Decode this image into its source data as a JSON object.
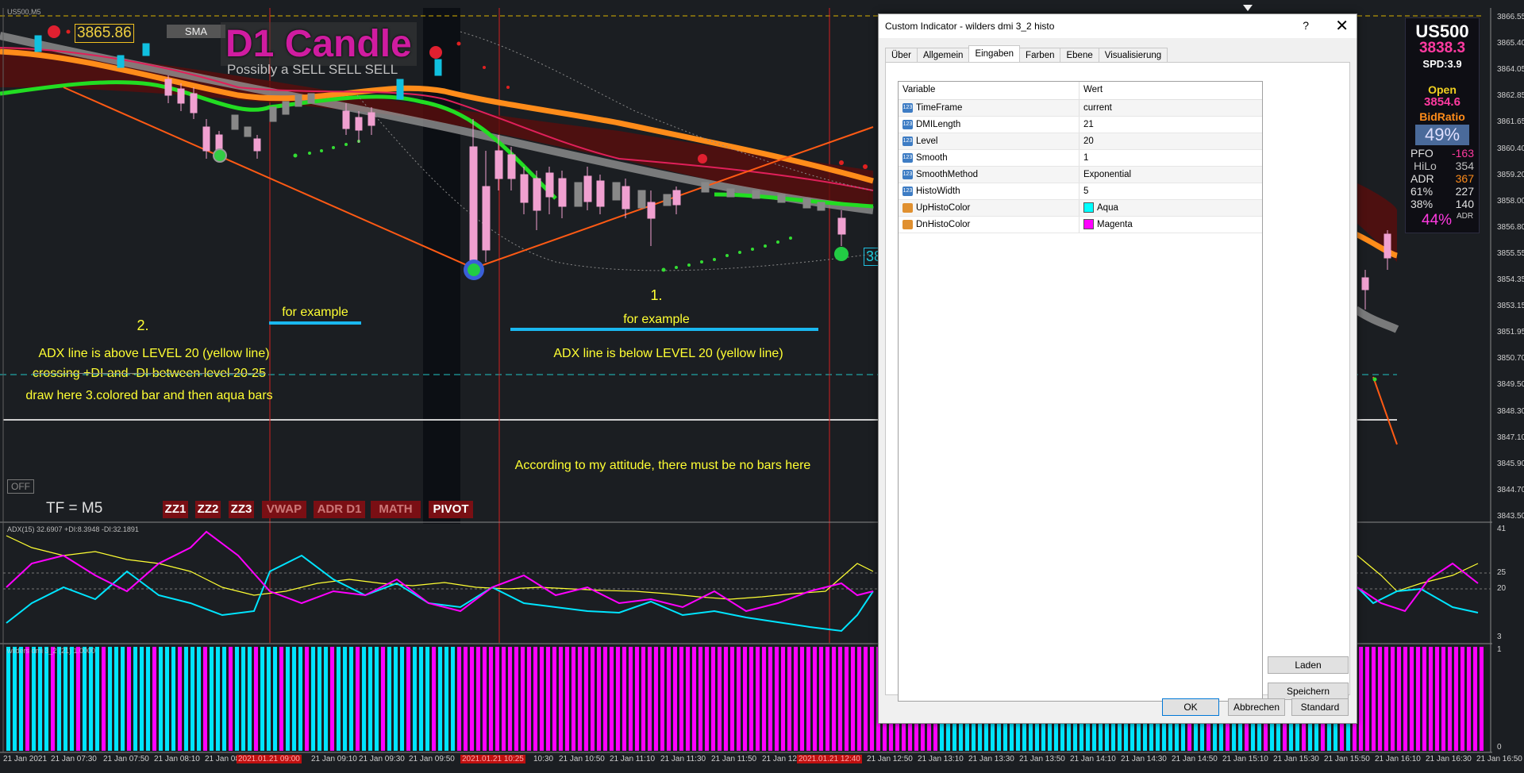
{
  "chart_window": {
    "title": "US500,M5",
    "current_price": "3865.86",
    "sma_label": "SMA",
    "d1_title": "D1 Candle",
    "d1_subtitle": "Possibly a SELL SELL SELL",
    "timeframe": "TF = M5",
    "off_label": "OFF",
    "bottom_price_box": "38",
    "buttons": [
      "ZZ1",
      "ZZ2",
      "ZZ3",
      "VWAP",
      "ADR D1",
      "MATH",
      "PIVOT"
    ],
    "annotations": {
      "label_2": "2.",
      "for_example_left": "for example",
      "adx_above": "ADX line is above LEVEL 20 (yellow line)",
      "crossing": "crossing +DI and -DI between level 20-25",
      "draw_here": "draw here 3.colored bar and then aqua bars",
      "label_1": "1.",
      "for_example_right": "for example",
      "adx_below": "ADX line is below LEVEL 20 (yellow line)",
      "no_bars": "According to my attitude, there must be no bars here"
    },
    "adx_title": "ADX(15) 32.6907 +DI:8.3948 -DI:32.1891",
    "histo_title": "wilders dmi 3_2 (21) 1.0000",
    "price_axis": [
      "3866.55",
      "3865.40",
      "3864.05",
      "3862.85",
      "3861.65",
      "3860.40",
      "3859.20",
      "3858.00",
      "3856.80",
      "3855.55",
      "3854.35",
      "3853.15",
      "3851.95",
      "3850.70",
      "3849.50",
      "3848.30",
      "3847.10",
      "3845.90",
      "3844.70",
      "3843.50"
    ],
    "adx_axis": [
      "41",
      "25",
      "20",
      "3"
    ],
    "histo_axis": [
      "1",
      "0"
    ],
    "time_axis": [
      "21 Jan 2021",
      "21 Jan 07:30",
      "21 Jan 07:50",
      "21 Jan 08:10",
      "21 Jan 08:",
      "2021.01.21 09:00",
      "21 Jan 09:10",
      "21 Jan 09:30",
      "21 Jan 09:50",
      "2021.01.21 10:25",
      "10:30",
      "21 Jan 10:50",
      "21 Jan 11:10",
      "21 Jan 11:30",
      "21 Jan 11:50",
      "21 Jan 12:",
      "2021.01.21 12:40",
      "21 Jan 12:50",
      "21 Jan 13:10",
      "21 Jan 13:30",
      "21 Jan 13:50",
      "21 Jan 14:10",
      "21 Jan 14:30",
      "21 Jan 14:50",
      "21 Jan 15:10",
      "21 Jan 15:30",
      "21 Jan 15:50",
      "21 Jan 16:10",
      "21 Jan 16:30",
      "21 Jan 16:50"
    ]
  },
  "info_panel": {
    "symbol": "US500",
    "bid": "3838.3",
    "spread": "SPD:3.9",
    "open_label": "Open",
    "open_value": "3854.6",
    "bidratio_label": "BidRatio",
    "bidratio_value": "49%",
    "rows": [
      {
        "label": "PFO",
        "value": "-163"
      },
      {
        "label": "HiLo",
        "value": "354"
      },
      {
        "label": "ADR",
        "value": "367"
      },
      {
        "label": "61%",
        "value": "227"
      },
      {
        "label": "38%",
        "value": "140"
      }
    ],
    "adr_pct": "44%",
    "adr_pct_label": "ADR"
  },
  "dialog": {
    "title": "Custom Indicator - wilders dmi 3_2 histo",
    "help": "?",
    "close": "✕",
    "tabs": [
      "Über",
      "Allgemein",
      "Eingaben",
      "Farben",
      "Ebene",
      "Visualisierung"
    ],
    "active_tab": "Eingaben",
    "col_variable": "Variable",
    "col_value": "Wert",
    "params": [
      {
        "name": "TimeFrame",
        "value": "current",
        "icon": "123"
      },
      {
        "name": "DMILength",
        "value": "21",
        "icon": "123"
      },
      {
        "name": "Level",
        "value": "20",
        "icon": "123"
      },
      {
        "name": "Smooth",
        "value": "1",
        "icon": "123"
      },
      {
        "name": "SmoothMethod",
        "value": "Exponential",
        "icon": "123"
      },
      {
        "name": "HistoWidth",
        "value": "5",
        "icon": "123"
      },
      {
        "name": "UpHistoColor",
        "value": "Aqua",
        "icon": "color",
        "swatch": "#00ffff"
      },
      {
        "name": "DnHistoColor",
        "value": "Magenta",
        "icon": "color",
        "swatch": "#ff00ff"
      }
    ],
    "load_button": "Laden",
    "save_button": "Speichern",
    "ok_button": "OK",
    "cancel_button": "Abbrechen",
    "default_button": "Standard"
  },
  "colors": {
    "background": "#1b1e22",
    "aqua": "#00e5ff",
    "magenta": "#ff00ff",
    "yellow_level": "#ffff33",
    "orange_ma": "#ff8c1a",
    "annotation_blue": "#1ab8f0"
  }
}
